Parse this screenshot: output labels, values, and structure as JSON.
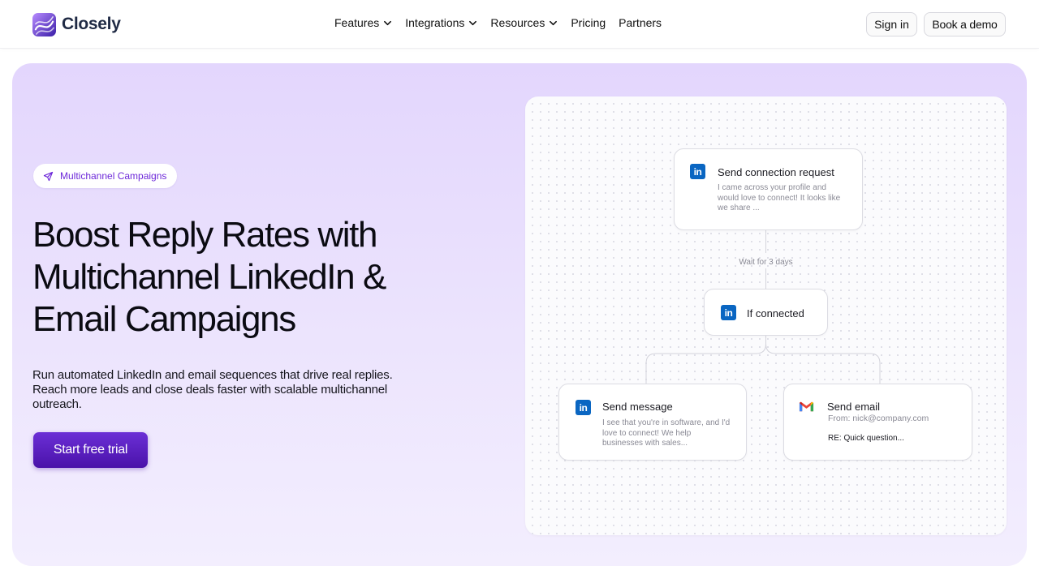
{
  "brand": {
    "name": "Closely"
  },
  "nav": {
    "items": [
      {
        "label": "Features",
        "dropdown": true
      },
      {
        "label": "Integrations",
        "dropdown": true
      },
      {
        "label": "Resources",
        "dropdown": true
      },
      {
        "label": "Pricing",
        "dropdown": false
      },
      {
        "label": "Partners",
        "dropdown": false
      }
    ],
    "sign_in": "Sign in",
    "book_demo": "Book a demo"
  },
  "hero": {
    "badge": "Multichannel Campaigns",
    "headline": "Boost Reply Rates with Multichannel LinkedIn & Email Campaigns",
    "subtext": "Run automated LinkedIn and email sequences that drive real replies. Reach more leads and close deals faster with scalable multichannel outreach.",
    "cta": "Start free trial"
  },
  "flow": {
    "step1": {
      "title": "Send connection request",
      "text": "I came across your profile and would love to connect! It looks like we share ...",
      "icon": "linkedin-icon"
    },
    "wait": "Wait for 3 days",
    "condition": {
      "title": "If connected",
      "icon": "linkedin-icon"
    },
    "branch_left": {
      "title": "Send message",
      "text": "I see that you're in software, and I'd love to connect! We help businesses with sales...",
      "icon": "linkedin-icon"
    },
    "branch_right": {
      "title": "Send email",
      "from": "From: nick@company.com",
      "subject": "RE: Quick question...",
      "icon": "gmail-icon"
    }
  },
  "colors": {
    "accent": "#6d28d9",
    "cta": "#5b21b6",
    "hero_bg": "#e6dafd",
    "linkedin": "#0a66c2"
  }
}
